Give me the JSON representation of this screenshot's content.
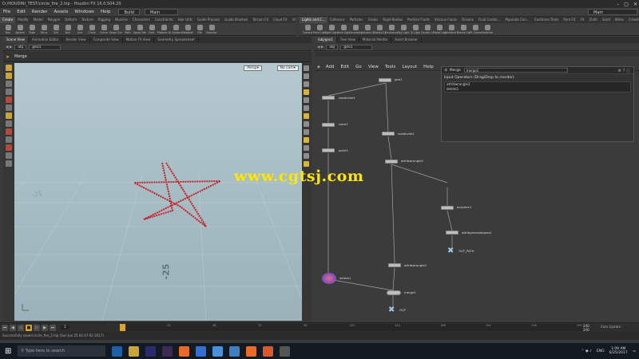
{
  "window": {
    "title": "D:/HOUDINI_TEST/circle_fire_2.hip - Houdini FX 16.0.504.20"
  },
  "menubar": {
    "items": [
      "File",
      "Edit",
      "Render",
      "Assets",
      "Windows",
      "Help"
    ],
    "build_label": "Build",
    "main_label": "Main",
    "main_label_right": "Main"
  },
  "shelf": {
    "left_tabs": [
      "Create",
      "Modify",
      "Model",
      "Polygon",
      "Deform",
      "Texture",
      "Rigging",
      "Muscles",
      "Characters",
      "Constraints",
      "Hair Utils",
      "Guide Process",
      "Guide Brushes",
      "Terrain FX",
      "Cloud FX",
      "Volume"
    ],
    "right_tabs": [
      "Lights and C...",
      "Collisions",
      "Particles",
      "Grains",
      "Rigid Bodies",
      "Particle Fluids",
      "Viscous Fluids",
      "Oceans",
      "Fluid Contai...",
      "Populate Con...",
      "Container Tools",
      "Pyro FX",
      "FX",
      "Cloth",
      "Solid",
      "Wires",
      "Crowds",
      "Drive Simula..."
    ],
    "left_tools": [
      "Box",
      "Sphere",
      "Tube",
      "Torus",
      "Grid",
      "Null",
      "Line",
      "Circle",
      "Curve",
      "Draw Curve",
      "Path",
      "Spray Paint",
      "Font",
      "Platonic Solids",
      "L-System",
      "Metaball",
      "File",
      "Selector"
    ],
    "right_tools": [
      "Camera",
      "Point Light",
      "Spot Light",
      "Area Light",
      "Geometry Light",
      "Volume Light",
      "Distant Light",
      "Environment Light",
      "Sky Light",
      "GI Light",
      "Caustic Light",
      "Portal Light",
      "Ambient Light",
      "Stereo Camera",
      "VR Camera",
      "Switcher"
    ]
  },
  "viewport_pane": {
    "tabs": [
      "Scene View",
      "Animation Editor",
      "Render View",
      "Composite View",
      "Motion FX View",
      "Geometry Spreadsheet"
    ],
    "path": [
      "obj",
      "geo1"
    ],
    "title": "Merge",
    "persp_label": "Persp",
    "cam_label": "No cam",
    "grid_labels": [
      "-25",
      "-25"
    ]
  },
  "network_pane": {
    "tabs": [
      "/obj/geo1",
      "Tree View",
      "Material Palette",
      "Asset Browser"
    ],
    "path": [
      "obj",
      "geo1"
    ],
    "menu": [
      "Add",
      "Edit",
      "Go",
      "View",
      "Tools",
      "Layout",
      "Help"
    ],
    "nodes": [
      {
        "label": "geo1"
      },
      {
        "label": "subdivide1"
      },
      {
        "label": "color1"
      },
      {
        "label": "paint1"
      },
      {
        "label": "subdivide1"
      },
      {
        "label": "attribwrangle2"
      },
      {
        "label": "polywire1"
      },
      {
        "label": "attribpromotegeos1"
      },
      {
        "label": "OUT_PATH"
      },
      {
        "label": "attribwrangle3"
      },
      {
        "label": "delete1"
      },
      {
        "label": "merge1"
      },
      {
        "label": "OUT"
      }
    ]
  },
  "popup": {
    "node_type": "Merge",
    "node_name": "merge1",
    "section_label": "Input Operators (Drag/Drop to reorder)",
    "inputs": [
      "attribwrangle3",
      "delete1"
    ]
  },
  "timeline": {
    "current_frame": "1",
    "start_frame": "1",
    "end_frame": "1",
    "ticks": [
      "1",
      "24",
      "48",
      "72",
      "96",
      "120",
      "144",
      "168",
      "192",
      "216",
      "240"
    ],
    "range_end_a": "240",
    "range_end_b": "240",
    "auto_update": "Auto Update"
  },
  "statusbar": {
    "message": "Successfully saved circle_fire_2.hip (Sun Jun 25 01:07:02 2017)"
  },
  "taskbar": {
    "search_placeholder": "Type here to search",
    "lang": "ENG",
    "time": "1:09 AM",
    "date": "6/25/2017"
  },
  "watermark": {
    "text": "www.cgtsj.com"
  },
  "colors": {
    "accent": "#d9a530",
    "star_curve": "#c4202a",
    "viewport_bg": "#a9bfc6",
    "taskbar": "#141a22"
  }
}
